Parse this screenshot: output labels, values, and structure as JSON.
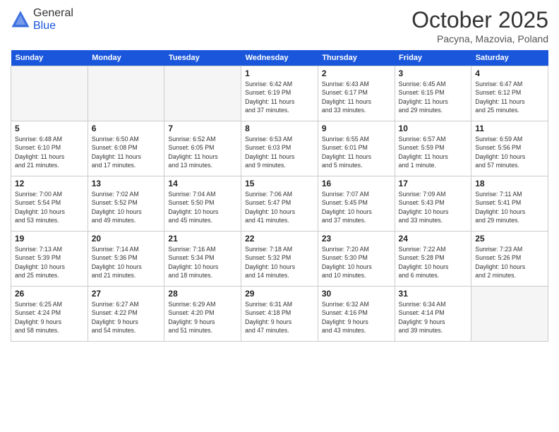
{
  "logo": {
    "general": "General",
    "blue": "Blue"
  },
  "header": {
    "month": "October 2025",
    "location": "Pacyna, Mazovia, Poland"
  },
  "weekdays": [
    "Sunday",
    "Monday",
    "Tuesday",
    "Wednesday",
    "Thursday",
    "Friday",
    "Saturday"
  ],
  "weeks": [
    [
      {
        "day": "",
        "info": ""
      },
      {
        "day": "",
        "info": ""
      },
      {
        "day": "",
        "info": ""
      },
      {
        "day": "1",
        "info": "Sunrise: 6:42 AM\nSunset: 6:19 PM\nDaylight: 11 hours\nand 37 minutes."
      },
      {
        "day": "2",
        "info": "Sunrise: 6:43 AM\nSunset: 6:17 PM\nDaylight: 11 hours\nand 33 minutes."
      },
      {
        "day": "3",
        "info": "Sunrise: 6:45 AM\nSunset: 6:15 PM\nDaylight: 11 hours\nand 29 minutes."
      },
      {
        "day": "4",
        "info": "Sunrise: 6:47 AM\nSunset: 6:12 PM\nDaylight: 11 hours\nand 25 minutes."
      }
    ],
    [
      {
        "day": "5",
        "info": "Sunrise: 6:48 AM\nSunset: 6:10 PM\nDaylight: 11 hours\nand 21 minutes."
      },
      {
        "day": "6",
        "info": "Sunrise: 6:50 AM\nSunset: 6:08 PM\nDaylight: 11 hours\nand 17 minutes."
      },
      {
        "day": "7",
        "info": "Sunrise: 6:52 AM\nSunset: 6:05 PM\nDaylight: 11 hours\nand 13 minutes."
      },
      {
        "day": "8",
        "info": "Sunrise: 6:53 AM\nSunset: 6:03 PM\nDaylight: 11 hours\nand 9 minutes."
      },
      {
        "day": "9",
        "info": "Sunrise: 6:55 AM\nSunset: 6:01 PM\nDaylight: 11 hours\nand 5 minutes."
      },
      {
        "day": "10",
        "info": "Sunrise: 6:57 AM\nSunset: 5:59 PM\nDaylight: 11 hours\nand 1 minute."
      },
      {
        "day": "11",
        "info": "Sunrise: 6:59 AM\nSunset: 5:56 PM\nDaylight: 10 hours\nand 57 minutes."
      }
    ],
    [
      {
        "day": "12",
        "info": "Sunrise: 7:00 AM\nSunset: 5:54 PM\nDaylight: 10 hours\nand 53 minutes."
      },
      {
        "day": "13",
        "info": "Sunrise: 7:02 AM\nSunset: 5:52 PM\nDaylight: 10 hours\nand 49 minutes."
      },
      {
        "day": "14",
        "info": "Sunrise: 7:04 AM\nSunset: 5:50 PM\nDaylight: 10 hours\nand 45 minutes."
      },
      {
        "day": "15",
        "info": "Sunrise: 7:06 AM\nSunset: 5:47 PM\nDaylight: 10 hours\nand 41 minutes."
      },
      {
        "day": "16",
        "info": "Sunrise: 7:07 AM\nSunset: 5:45 PM\nDaylight: 10 hours\nand 37 minutes."
      },
      {
        "day": "17",
        "info": "Sunrise: 7:09 AM\nSunset: 5:43 PM\nDaylight: 10 hours\nand 33 minutes."
      },
      {
        "day": "18",
        "info": "Sunrise: 7:11 AM\nSunset: 5:41 PM\nDaylight: 10 hours\nand 29 minutes."
      }
    ],
    [
      {
        "day": "19",
        "info": "Sunrise: 7:13 AM\nSunset: 5:39 PM\nDaylight: 10 hours\nand 25 minutes."
      },
      {
        "day": "20",
        "info": "Sunrise: 7:14 AM\nSunset: 5:36 PM\nDaylight: 10 hours\nand 21 minutes."
      },
      {
        "day": "21",
        "info": "Sunrise: 7:16 AM\nSunset: 5:34 PM\nDaylight: 10 hours\nand 18 minutes."
      },
      {
        "day": "22",
        "info": "Sunrise: 7:18 AM\nSunset: 5:32 PM\nDaylight: 10 hours\nand 14 minutes."
      },
      {
        "day": "23",
        "info": "Sunrise: 7:20 AM\nSunset: 5:30 PM\nDaylight: 10 hours\nand 10 minutes."
      },
      {
        "day": "24",
        "info": "Sunrise: 7:22 AM\nSunset: 5:28 PM\nDaylight: 10 hours\nand 6 minutes."
      },
      {
        "day": "25",
        "info": "Sunrise: 7:23 AM\nSunset: 5:26 PM\nDaylight: 10 hours\nand 2 minutes."
      }
    ],
    [
      {
        "day": "26",
        "info": "Sunrise: 6:25 AM\nSunset: 4:24 PM\nDaylight: 9 hours\nand 58 minutes."
      },
      {
        "day": "27",
        "info": "Sunrise: 6:27 AM\nSunset: 4:22 PM\nDaylight: 9 hours\nand 54 minutes."
      },
      {
        "day": "28",
        "info": "Sunrise: 6:29 AM\nSunset: 4:20 PM\nDaylight: 9 hours\nand 51 minutes."
      },
      {
        "day": "29",
        "info": "Sunrise: 6:31 AM\nSunset: 4:18 PM\nDaylight: 9 hours\nand 47 minutes."
      },
      {
        "day": "30",
        "info": "Sunrise: 6:32 AM\nSunset: 4:16 PM\nDaylight: 9 hours\nand 43 minutes."
      },
      {
        "day": "31",
        "info": "Sunrise: 6:34 AM\nSunset: 4:14 PM\nDaylight: 9 hours\nand 39 minutes."
      },
      {
        "day": "",
        "info": ""
      }
    ]
  ]
}
